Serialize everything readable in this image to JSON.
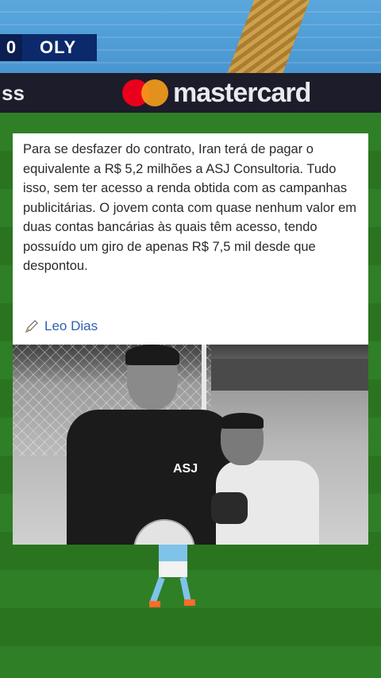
{
  "scoreboard": {
    "score": "0",
    "team": "OLY"
  },
  "adboard": {
    "left_text": "ss",
    "brand": "mastercard"
  },
  "post": {
    "text": "Para se desfazer do contrato, Iran terá de pagar o equivalente a R$ 5,2 milhões a ASJ Consultoria. Tudo isso, sem ter acesso a renda obtida com as campanhas publicitárias. O jovem conta com quase nenhum valor em duas contas bancárias às quais têm acesso, tendo possuído um giro de apenas R$ 7,5 mil desde que despontou.",
    "source_icon": "pen-icon",
    "source": "Leo Dias",
    "photo_logo": "ASJ"
  },
  "colors": {
    "source_link": "#2f5fb0",
    "scorebug": "#0c2a6b",
    "pitch": "#2f7a24"
  }
}
